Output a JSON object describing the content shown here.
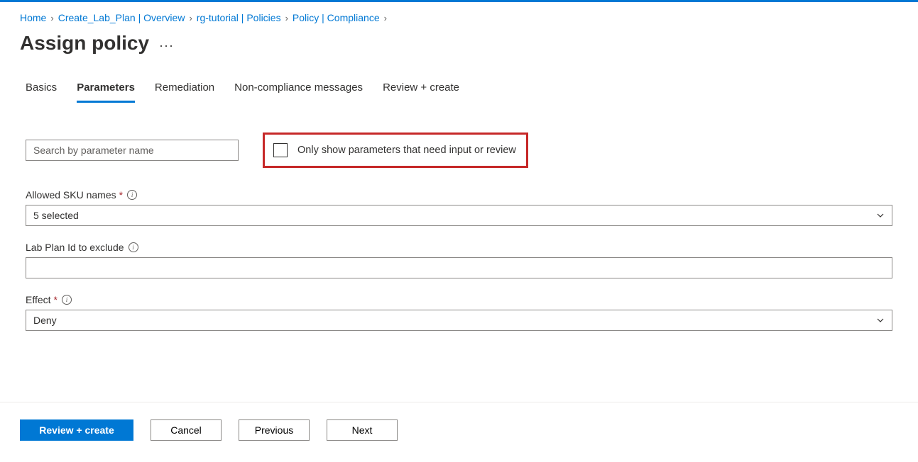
{
  "breadcrumb": [
    {
      "label": "Home"
    },
    {
      "label": "Create_Lab_Plan | Overview"
    },
    {
      "label": "rg-tutorial | Policies"
    },
    {
      "label": "Policy | Compliance"
    }
  ],
  "page_title": "Assign policy",
  "tabs": [
    {
      "label": "Basics",
      "active": false
    },
    {
      "label": "Parameters",
      "active": true
    },
    {
      "label": "Remediation",
      "active": false
    },
    {
      "label": "Non-compliance messages",
      "active": false
    },
    {
      "label": "Review + create",
      "active": false
    }
  ],
  "search": {
    "placeholder": "Search by parameter name"
  },
  "filter_checkbox": {
    "label": "Only show parameters that need input or review",
    "checked": false
  },
  "fields": {
    "allowed_sku": {
      "label": "Allowed SKU names",
      "required": true,
      "value": "5 selected"
    },
    "lab_plan_id": {
      "label": "Lab Plan Id to exclude",
      "required": false,
      "value": ""
    },
    "effect": {
      "label": "Effect",
      "required": true,
      "value": "Deny"
    }
  },
  "footer": {
    "review_create": "Review + create",
    "cancel": "Cancel",
    "previous": "Previous",
    "next": "Next"
  }
}
